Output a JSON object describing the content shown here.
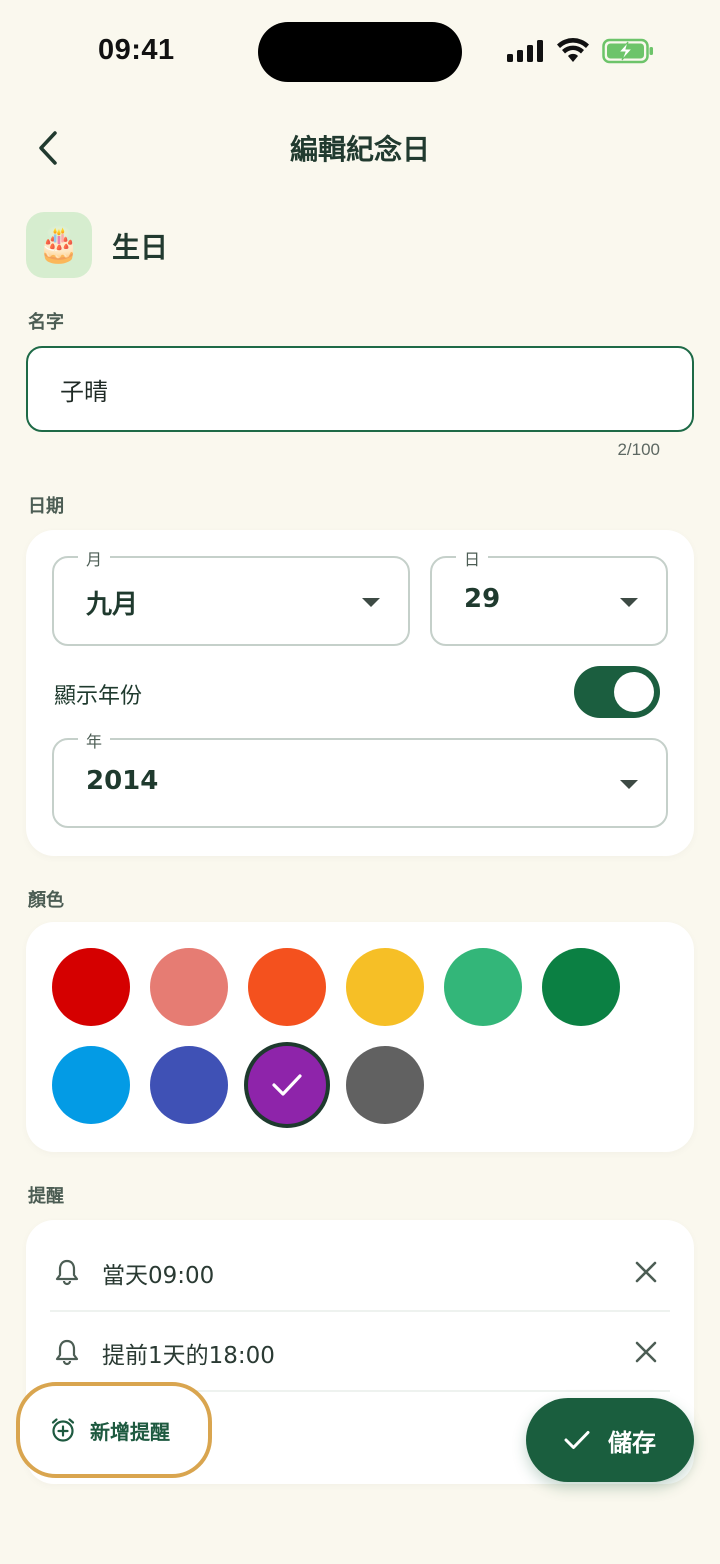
{
  "status": {
    "time": "09:41"
  },
  "header": {
    "title": "編輯紀念日",
    "back_icon": "chevron-left-icon"
  },
  "type": {
    "emoji": "🎂",
    "label": "生日",
    "icon_bg": "#D6EDCF"
  },
  "name": {
    "label": "名字",
    "value": "子晴",
    "counter": "2/100"
  },
  "date": {
    "label": "日期",
    "month": {
      "label": "月",
      "value": "九月"
    },
    "day": {
      "label": "日",
      "value": "29"
    },
    "show_year_label": "顯示年份",
    "show_year_on": true,
    "year": {
      "label": "年",
      "value": "2014"
    }
  },
  "colors": {
    "label": "顏色",
    "swatches": [
      "#D50000",
      "#E67C73",
      "#F4511E",
      "#F6BF26",
      "#33B679",
      "#0B8043",
      "#039BE5",
      "#3F51B5",
      "#8E24AA",
      "#616161"
    ],
    "selected": "#8E24AA"
  },
  "reminders": {
    "label": "提醒",
    "items": [
      {
        "text": "當天09:00"
      },
      {
        "text": "提前1天的18:00"
      }
    ],
    "add_label": "新增提醒"
  },
  "save": {
    "label": "儲存"
  },
  "theme": {
    "primary": "#1A5E3E",
    "background": "#FAF8EE",
    "highlight": "#D9A54F"
  }
}
